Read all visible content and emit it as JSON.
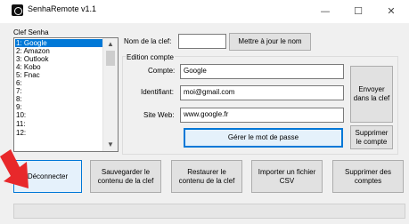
{
  "window": {
    "title": "SenhaRemote v1.1",
    "controls": {
      "minimize": "—",
      "maximize": "☐",
      "close": "✕"
    }
  },
  "clef_list": {
    "label": "Clef Senha",
    "items": [
      "1: Google",
      "2: Amazon",
      "3: Outlook",
      "4: Kobo",
      "5: Fnac",
      "6:",
      "7:",
      "8:",
      "9:",
      "10:",
      "11:",
      "12:"
    ],
    "selected": "1: Google"
  },
  "nom_clef": {
    "label": "Nom de la clef:",
    "value": "",
    "update_button": "Mettre à jour le nom"
  },
  "edition": {
    "group_label": "Edition compte",
    "compte_label": "Compte:",
    "compte_value": "Google",
    "identifiant_label": "Identifiant:",
    "identifiant_value": "moi@gmail.com",
    "siteweb_label": "Site Web:",
    "siteweb_value": "www.google.fr",
    "manage_password_button": "Gérer le mot de passe",
    "send_to_key_button": "Envoyer dans la clef",
    "delete_account_button": "Supprimer le compte"
  },
  "bottom_buttons": {
    "disconnect": "Déconnecter",
    "save_key": "Sauvegarder le contenu de la clef",
    "restore_key": "Restaurer le contenu de la clef",
    "import_csv": "Importer un fichier CSV",
    "delete_accounts": "Supprimer des comptes"
  },
  "colors": {
    "selection": "#0078d7",
    "arrow": "#e8282b"
  }
}
